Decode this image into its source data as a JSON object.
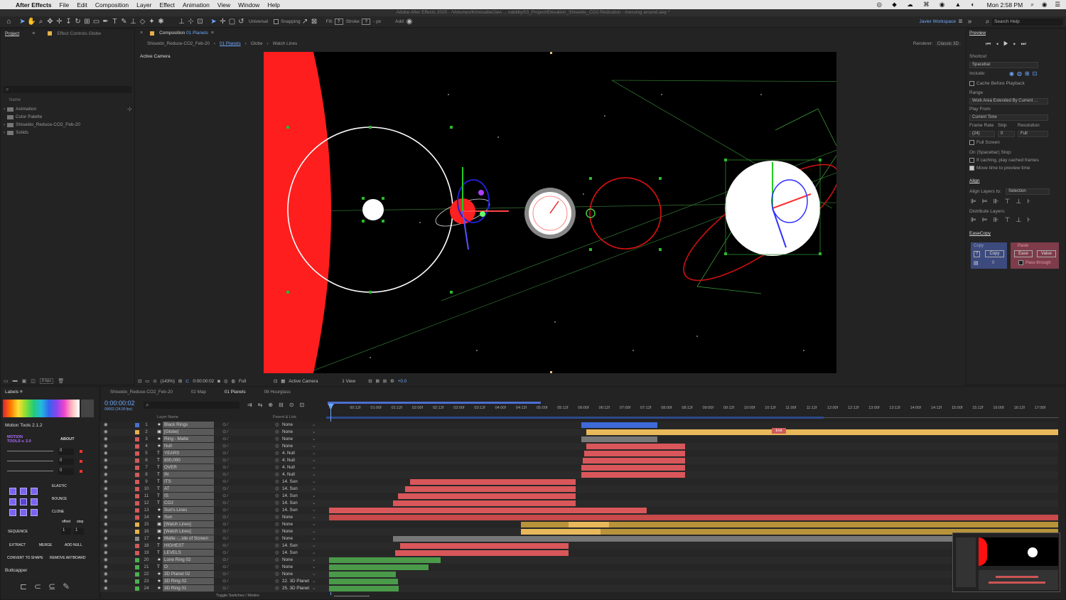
{
  "menubar": {
    "apple": "",
    "app": "After Effects",
    "items": [
      "File",
      "Edit",
      "Composition",
      "Layer",
      "Effect",
      "Animation",
      "View",
      "Window",
      "Help"
    ],
    "clock": "Mon 2:58 PM"
  },
  "title": "Adobe After Effects 2020 - /Volumes/Kimosabe/Javi ... nability/03_Project/Elevation_Shiseido_CO2-Redcution - messing around.aep *",
  "toolbar": {
    "universal": "Universal",
    "snapping": "Snapping",
    "fill_label": "Fill:",
    "fill_val": "?",
    "stroke_label": "Stroke:",
    "stroke_val": "?",
    "px": "- px",
    "add": "Add:",
    "workspace": "Javier Workspace",
    "search": "Search Help"
  },
  "project": {
    "tab1": "Project",
    "tab2": "Effect Controls Globe",
    "col": "Name",
    "items": [
      "Animation",
      "Color Palette",
      "Shiseido_Reduce-CO2_Feb-20",
      "Solids"
    ],
    "bpc": "8 bpc"
  },
  "comp": {
    "tab": "Composition",
    "tab_hl": "01 Planets",
    "crumbs": [
      "Shiseido_Reduce-CO2_Feb-20",
      "01 Planets",
      "Globe",
      "Watch Lines"
    ],
    "renderer_label": "Renderer:",
    "renderer": "Classic 3D",
    "camera": "Active Camera",
    "footer": {
      "zoom": "(143%)",
      "time": "0:00:00:02",
      "res": "Full",
      "cam": "Active Camera",
      "views": "1 View",
      "exp": "+0.0"
    }
  },
  "preview": {
    "title": "Preview",
    "shortcut_label": "Shortcut",
    "shortcut": "Spacebar",
    "include": "Include:",
    "cache": "Cache Before Playback",
    "range_label": "Range",
    "range": "Work Area Extended By Current ...",
    "playfrom_label": "Play From",
    "playfrom": "Current Time",
    "fr_label": "Frame Rate",
    "skip_label": "Skip",
    "res_label": "Resolution",
    "fr": "(24)",
    "skip": "0",
    "res": "Full",
    "fullscreen": "Full Screen",
    "stop_label": "On (Spacebar) Stop:",
    "stop1": "If caching, play cached frames",
    "stop2": "Move time to preview time"
  },
  "align": {
    "title": "Align",
    "to_label": "Align Layers to:",
    "to": "Selection",
    "dist": "Distribute Layers:"
  },
  "easecopy": {
    "title": "EaseCopy",
    "copy": "Copy",
    "copy_btn": "Copy",
    "copy_val": "0",
    "paste": "Paste",
    "ease": "Ease",
    "value": "Value",
    "pass": "Pass-through",
    "q": "?"
  },
  "labels": {
    "title": "Labels"
  },
  "motion": {
    "title": "Motion Tools 2.1.2",
    "logo1": "MOTION",
    "logo2": "TOOLS v. 2.0",
    "about": "ABOUT",
    "vals": [
      "0",
      "0",
      "0"
    ],
    "elastic": "ELASTIC",
    "bounce": "BOUNCE",
    "clone": "CLONE",
    "offset": "offset",
    "step": "step",
    "sequence": "SEQUENCE",
    "seq_vals": [
      "1",
      "1"
    ],
    "extract": "EXTRACT",
    "merge": "MERGE",
    "addnull": "ADD NULL",
    "convert": "CONVERT TO SHAPE",
    "remove": "REMOVE ARTBOARD"
  },
  "buttcapper": {
    "title": "Buttcapper"
  },
  "timeline": {
    "tabs": [
      "Shiseido_Reduce-CO2_Feb-20",
      "02 Map",
      "01 Planets",
      "08 Hourglass"
    ],
    "time": "0:00:00:02",
    "fps": "00002 (24.00 fps)",
    "col_name": "Layer Name",
    "col_parent": "Parent & Link",
    "toggle": "Toggle Switches / Modes",
    "ticks": [
      "0f",
      "00:12f",
      "01:00f",
      "01:12f",
      "02:00f",
      "02:12f",
      "03:00f",
      "03:12f",
      "04:00f",
      "04:12f",
      "05:00f",
      "05:12f",
      "06:00f",
      "06:12f",
      "07:00f",
      "07:12f",
      "08:00f",
      "08:12f",
      "09:00f",
      "09:12f",
      "10:00f",
      "10:12f",
      "11:00f",
      "11:12f",
      "12:00f",
      "12:12f",
      "13:00f",
      "13:12f",
      "14:00f",
      "14:12f",
      "15:00f",
      "15:12f",
      "16:00f",
      "16:12f",
      "17:00f"
    ],
    "end_marker": "End",
    "layers": [
      {
        "n": "1",
        "name": "Black Rings",
        "type": "★",
        "parent": "None",
        "color": "#4a6fd0"
      },
      {
        "n": "2",
        "name": "[Globe]",
        "type": "▣",
        "parent": "None",
        "color": "#e6b04a"
      },
      {
        "n": "3",
        "name": "Ring - Matte",
        "type": "★",
        "parent": "None",
        "color": "#d05a5a"
      },
      {
        "n": "4",
        "name": "Null",
        "type": "★",
        "parent": "None",
        "color": "#d05a5a"
      },
      {
        "n": "5",
        "name": "YEARS",
        "type": "T",
        "parent": "4. Null",
        "color": "#d05a5a"
      },
      {
        "n": "6",
        "name": "800,000",
        "type": "T",
        "parent": "4. Null",
        "color": "#d05a5a"
      },
      {
        "n": "7",
        "name": "OVER",
        "type": "T",
        "parent": "4. Null",
        "color": "#d05a5a"
      },
      {
        "n": "8",
        "name": "IN",
        "type": "T",
        "parent": "4. Null",
        "color": "#d05a5a"
      },
      {
        "n": "9",
        "name": "ITS",
        "type": "T",
        "parent": "14. Sun",
        "color": "#d05a5a"
      },
      {
        "n": "10",
        "name": "AT",
        "type": "T",
        "parent": "14. Sun",
        "color": "#d05a5a"
      },
      {
        "n": "11",
        "name": "IS",
        "type": "T",
        "parent": "14. Sun",
        "color": "#d05a5a"
      },
      {
        "n": "12",
        "name": "CO2",
        "type": "T",
        "parent": "14. Sun",
        "color": "#d05a5a"
      },
      {
        "n": "13",
        "name": "Sun's Lines",
        "type": "★",
        "parent": "14. Sun",
        "color": "#d05a5a"
      },
      {
        "n": "14",
        "name": "Sun",
        "type": "★",
        "parent": "None",
        "color": "#d05a5a"
      },
      {
        "n": "15",
        "name": "[Watch Lines]",
        "type": "▣",
        "parent": "None",
        "color": "#e6b04a"
      },
      {
        "n": "16",
        "name": "[Watch Lines]",
        "type": "▣",
        "parent": "None",
        "color": "#e6b04a"
      },
      {
        "n": "17",
        "name": "Matte -...ide of Screen",
        "type": "★",
        "parent": "None",
        "color": "#888888"
      },
      {
        "n": "18",
        "name": "HIGHEST",
        "type": "T",
        "parent": "14. Sun",
        "color": "#d05a5a"
      },
      {
        "n": "19",
        "name": "LEVELS",
        "type": "T",
        "parent": "14. Sun",
        "color": "#d05a5a"
      },
      {
        "n": "20",
        "name": "Lone Ring 02",
        "type": "★",
        "parent": "None",
        "color": "#4caf50"
      },
      {
        "n": "21",
        "name": "O",
        "type": "T",
        "parent": "None",
        "color": "#4caf50"
      },
      {
        "n": "22",
        "name": "3D Planet 02",
        "type": "★",
        "parent": "None",
        "color": "#4caf50"
      },
      {
        "n": "23",
        "name": "3D Ring 02",
        "type": "★",
        "parent": "22. 3D Planet",
        "color": "#4caf50"
      },
      {
        "n": "24",
        "name": "3D Ring 01",
        "type": "★",
        "parent": "25. 3D Planet",
        "color": "#4caf50"
      }
    ]
  }
}
